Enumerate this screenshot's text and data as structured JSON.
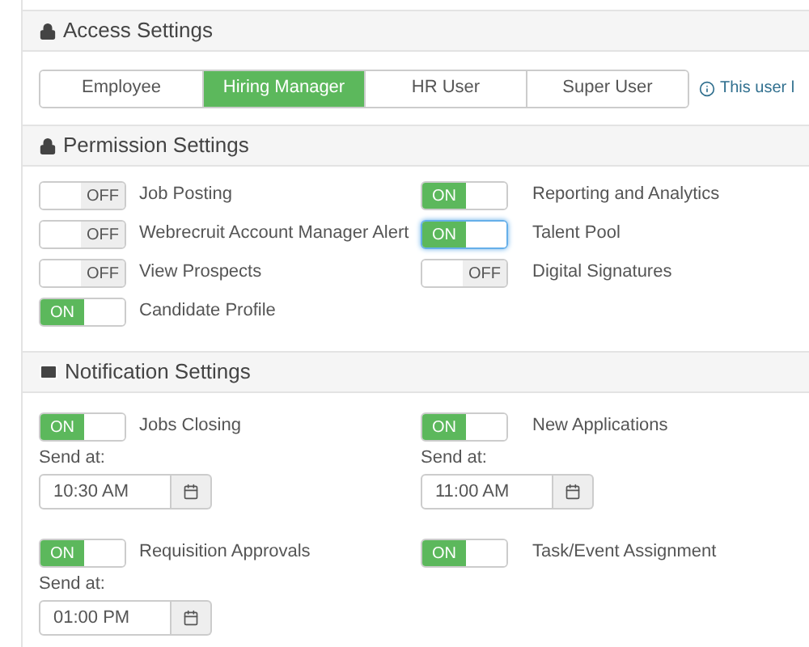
{
  "access_settings": {
    "title": "Access Settings",
    "tabs": [
      {
        "label": "Employee",
        "selected": false
      },
      {
        "label": "Hiring Manager",
        "selected": true
      },
      {
        "label": "HR User",
        "selected": false
      },
      {
        "label": "Super User",
        "selected": false
      }
    ],
    "info": "This user l"
  },
  "permission_settings": {
    "title": "Permission Settings",
    "toggles": [
      {
        "label": "Job Posting",
        "on": false,
        "state_label": "OFF",
        "focused": false
      },
      {
        "label": "Reporting and Analytics",
        "on": true,
        "state_label": "ON",
        "focused": false
      },
      {
        "label": "Webrecruit Account Manager Alert",
        "on": false,
        "state_label": "OFF",
        "focused": false
      },
      {
        "label": "Talent Pool",
        "on": true,
        "state_label": "ON",
        "focused": true
      },
      {
        "label": "View Prospects",
        "on": false,
        "state_label": "OFF",
        "focused": false
      },
      {
        "label": "Digital Signatures",
        "on": false,
        "state_label": "OFF",
        "focused": false
      },
      {
        "label": "Candidate Profile",
        "on": true,
        "state_label": "ON",
        "focused": false
      }
    ]
  },
  "notification_settings": {
    "title": "Notification Settings",
    "items": [
      {
        "label": "Jobs Closing",
        "on": true,
        "state_label": "ON",
        "send_at_label": "Send at:",
        "time": "10:30 AM"
      },
      {
        "label": "New Applications",
        "on": true,
        "state_label": "ON",
        "send_at_label": "Send at:",
        "time": "11:00 AM"
      },
      {
        "label": "Requisition Approvals",
        "on": true,
        "state_label": "ON",
        "send_at_label": "Send at:",
        "time": "01:00 PM"
      },
      {
        "label": "Task/Event Assignment",
        "on": true,
        "state_label": "ON"
      }
    ]
  }
}
